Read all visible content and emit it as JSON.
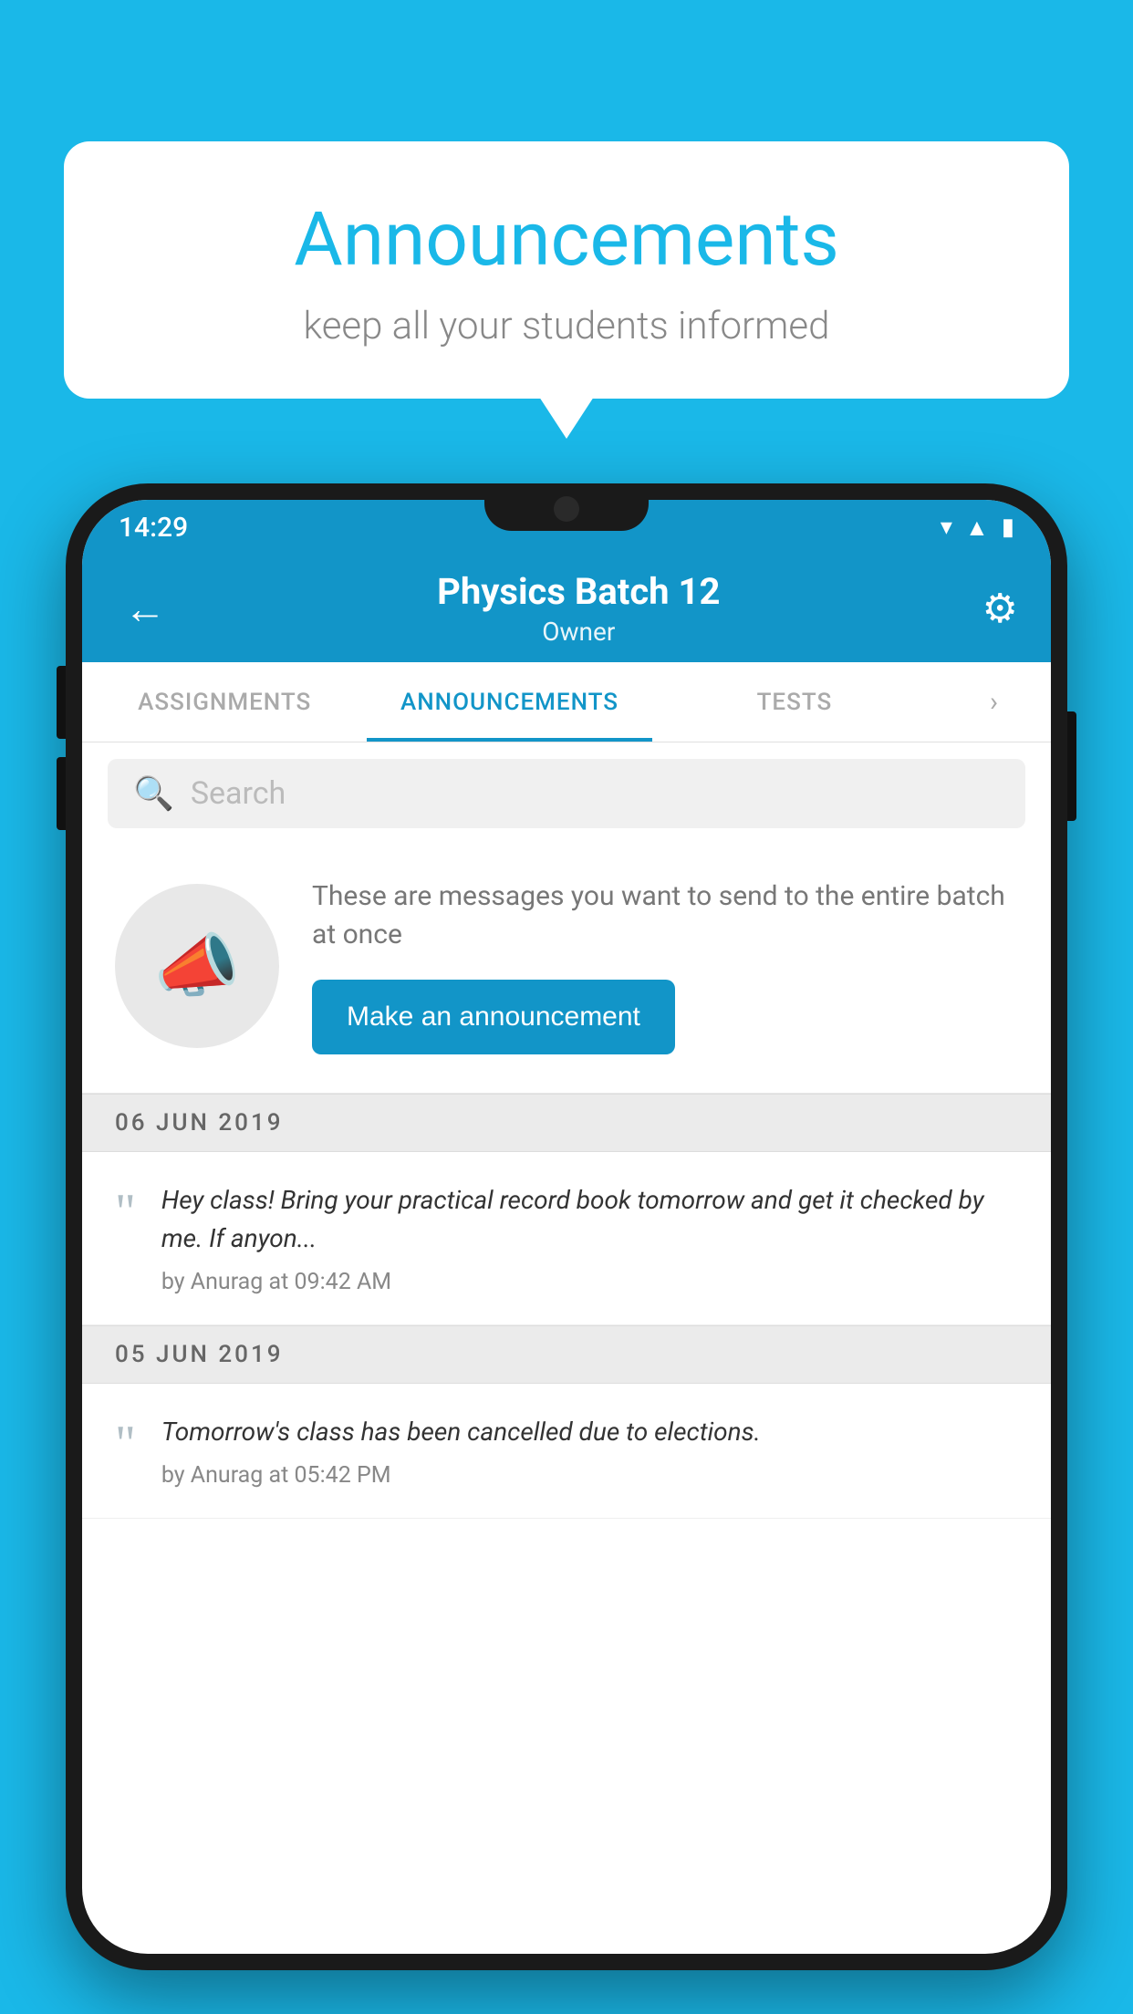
{
  "bubble": {
    "title": "Announcements",
    "subtitle": "keep all your students informed"
  },
  "statusBar": {
    "time": "14:29",
    "icons": [
      "wifi",
      "signal",
      "battery"
    ]
  },
  "appBar": {
    "title": "Physics Batch 12",
    "subtitle": "Owner",
    "back_label": "←",
    "gear_label": "⚙"
  },
  "tabs": [
    {
      "label": "ASSIGNMENTS",
      "active": false
    },
    {
      "label": "ANNOUNCEMENTS",
      "active": true
    },
    {
      "label": "TESTS",
      "active": false
    }
  ],
  "search": {
    "placeholder": "Search"
  },
  "promo": {
    "description": "These are messages you want to send to the entire batch at once",
    "button_label": "Make an announcement"
  },
  "announcements": [
    {
      "date": "06  JUN  2019",
      "text": "Hey class! Bring your practical record book tomorrow and get it checked by me. If anyon...",
      "meta": "by Anurag at 09:42 AM"
    },
    {
      "date": "05  JUN  2019",
      "text": "Tomorrow's class has been cancelled due to elections.",
      "meta": "by Anurag at 05:42 PM"
    }
  ]
}
